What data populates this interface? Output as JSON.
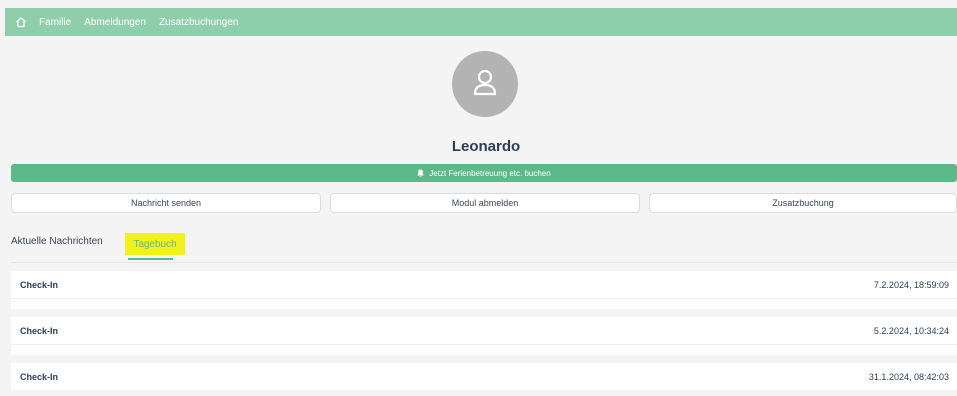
{
  "nav": {
    "home_icon": "home-icon",
    "links": [
      "Familie",
      "Abmeldungen",
      "Zusatzbuchungen"
    ]
  },
  "profile": {
    "avatar_icon": "user-icon",
    "name": "Leonardo"
  },
  "booking": {
    "icon": "bell-icon",
    "label": "Jetzt Ferienbetreuung etc. buchen"
  },
  "actions": {
    "message": "Nachricht senden",
    "unsubscribe": "Modul abmelden",
    "extra": "Zusatzbuchung"
  },
  "tabs": {
    "news": "Aktuelle Nachrichten",
    "diary": "Tagebuch",
    "active": "Tagebuch"
  },
  "entries": [
    {
      "title": "Check-In",
      "time": "7.2.2024, 18:59:09"
    },
    {
      "title": "Check-In",
      "time": "5.2.2024, 10:34:24"
    },
    {
      "title": "Check-In",
      "time": "31.1.2024, 08:42:03"
    }
  ],
  "colors": {
    "nav_bg": "#8fceab",
    "accent": "#5cb98a",
    "highlight": "#f2f21a"
  }
}
